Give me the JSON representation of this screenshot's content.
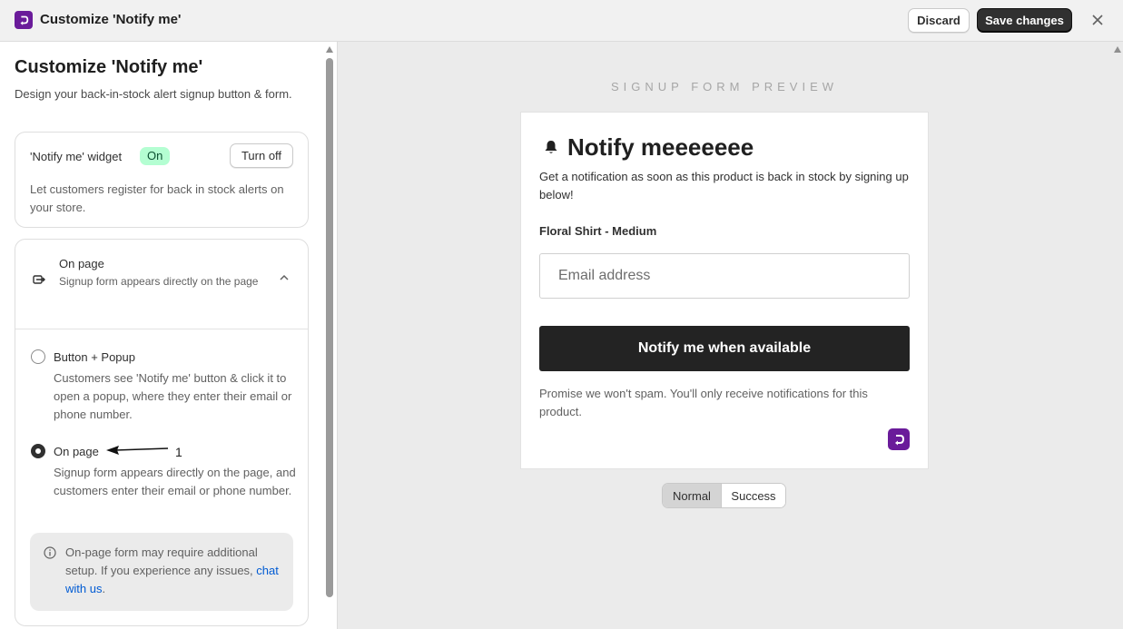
{
  "topbar": {
    "title": "Customize 'Notify me'",
    "discard_label": "Discard",
    "save_label": "Save changes",
    "logo_icon": "app-logo-icon",
    "close_icon": "close-icon"
  },
  "sidebar": {
    "title": "Customize 'Notify me'",
    "description": "Design your back-in-stock alert signup button & form.",
    "widget": {
      "label": "'Notify me' widget",
      "status": "On",
      "toggle_label": "Turn off",
      "description": "Let customers register for back in stock alerts on your store."
    },
    "placement": {
      "title": "On page",
      "subtitle": "Signup form appears directly on the page",
      "icon": "placement-icon",
      "chevron_icon": "chevron-up-icon",
      "options": [
        {
          "label": "Button + Popup",
          "description": "Customers see 'Notify me' button & click it to open a popup, where they enter their email or phone number.",
          "selected": false
        },
        {
          "label": "On page",
          "description": "Signup form appears directly on the page, and customers enter their email or phone number.",
          "selected": true
        }
      ],
      "annotation_number": "1",
      "info": {
        "text": "On-page form may require additional setup. If you experience any issues, ",
        "link_text": "chat with us",
        "suffix": "."
      }
    }
  },
  "preview": {
    "heading": "SIGNUP FORM PREVIEW",
    "form": {
      "title": "Notify meeeeeee",
      "description": "Get a notification as soon as this product is back in stock by signing up below!",
      "product": "Floral Shirt - Medium",
      "email_placeholder": "Email address",
      "button_label": "Notify me when available",
      "spam_note": "Promise we won't spam. You'll only receive notifications for this product."
    },
    "state_toggle": {
      "options": [
        "Normal",
        "Success"
      ],
      "selected": "Normal"
    }
  },
  "colors": {
    "brand": "#6a1b9a",
    "primary_button": "#303030",
    "badge_on_bg": "#b4fed2",
    "link": "#005bd3"
  }
}
